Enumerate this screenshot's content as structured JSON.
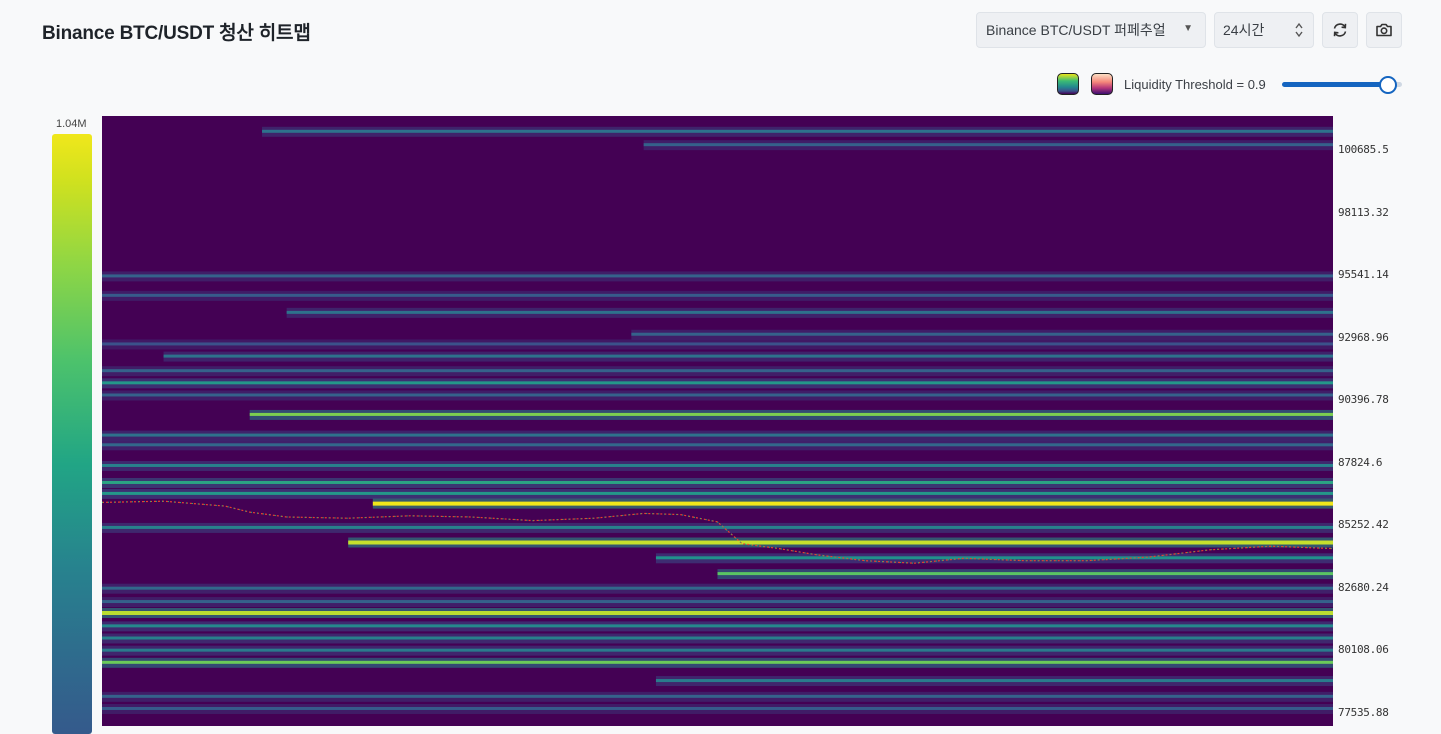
{
  "header": {
    "title": "Binance BTC/USDT 청산 히트맵",
    "symbol_select": "Binance BTC/USDT 퍼페추얼",
    "range_select": "24시간",
    "refresh_icon": "refresh-icon",
    "camera_icon": "camera-icon"
  },
  "controls": {
    "palette_icons": [
      "viridis-swatch",
      "magma-swatch"
    ],
    "threshold_label": "Liquidity Threshold = 0.9",
    "threshold_value": 0.9
  },
  "colorbar": {
    "max_label": "1.04M",
    "colors": [
      "#f0e71b",
      "#8ed645",
      "#21a585",
      "#2f6a8d"
    ]
  },
  "chart_data": {
    "type": "heatmap",
    "y_ticks": [
      "100685.5",
      "98113.32",
      "95541.14",
      "92968.96",
      "90396.78",
      "87824.6",
      "85252.42",
      "82680.24",
      "80108.06",
      "77535.88"
    ],
    "y_tick_values": [
      100685.5,
      98113.32,
      95541.14,
      92968.96,
      90396.78,
      87824.6,
      85252.42,
      82680.24,
      80108.06,
      77535.88
    ],
    "ylim": [
      77000,
      102100
    ],
    "time_range": "24시간",
    "background_color": "#440154",
    "liquidation_bands": [
      {
        "price": 101450,
        "intensity": 0.35,
        "start": 0.13
      },
      {
        "price": 100900,
        "intensity": 0.3,
        "start": 0.44
      },
      {
        "price": 95500,
        "intensity": 0.3,
        "start": 0.0
      },
      {
        "price": 94700,
        "intensity": 0.28,
        "start": 0.0
      },
      {
        "price": 94000,
        "intensity": 0.35,
        "start": 0.15
      },
      {
        "price": 93100,
        "intensity": 0.3,
        "start": 0.43
      },
      {
        "price": 92700,
        "intensity": 0.25,
        "start": 0.0
      },
      {
        "price": 92200,
        "intensity": 0.35,
        "start": 0.05
      },
      {
        "price": 91600,
        "intensity": 0.3,
        "start": 0.0
      },
      {
        "price": 91100,
        "intensity": 0.48,
        "start": 0.0
      },
      {
        "price": 90600,
        "intensity": 0.3,
        "start": 0.0
      },
      {
        "price": 89800,
        "intensity": 0.78,
        "start": 0.12
      },
      {
        "price": 88950,
        "intensity": 0.35,
        "start": 0.0
      },
      {
        "price": 88550,
        "intensity": 0.32,
        "start": 0.0
      },
      {
        "price": 87700,
        "intensity": 0.4,
        "start": 0.0
      },
      {
        "price": 87000,
        "intensity": 0.55,
        "start": 0.0
      },
      {
        "price": 86550,
        "intensity": 0.48,
        "start": 0.0
      },
      {
        "price": 86150,
        "intensity": 1.0,
        "start": 0.22
      },
      {
        "price": 85150,
        "intensity": 0.4,
        "start": 0.0
      },
      {
        "price": 84550,
        "intensity": 0.92,
        "start": 0.2
      },
      {
        "price": 83900,
        "intensity": 0.45,
        "start": 0.45
      },
      {
        "price": 83250,
        "intensity": 0.72,
        "start": 0.5
      },
      {
        "price": 82650,
        "intensity": 0.32,
        "start": 0.0
      },
      {
        "price": 82100,
        "intensity": 0.3,
        "start": 0.0
      },
      {
        "price": 81650,
        "intensity": 0.9,
        "start": 0.0
      },
      {
        "price": 81100,
        "intensity": 0.42,
        "start": 0.0
      },
      {
        "price": 80600,
        "intensity": 0.4,
        "start": 0.0
      },
      {
        "price": 80100,
        "intensity": 0.38,
        "start": 0.0
      },
      {
        "price": 79600,
        "intensity": 0.75,
        "start": 0.0
      },
      {
        "price": 78850,
        "intensity": 0.38,
        "start": 0.45
      },
      {
        "price": 78200,
        "intensity": 0.3,
        "start": 0.0
      },
      {
        "price": 77700,
        "intensity": 0.28,
        "start": 0.0
      }
    ],
    "price_series": [
      {
        "t": 0.0,
        "price": 86200
      },
      {
        "t": 0.05,
        "price": 86250
      },
      {
        "t": 0.1,
        "price": 86050
      },
      {
        "t": 0.12,
        "price": 85800
      },
      {
        "t": 0.15,
        "price": 85600
      },
      {
        "t": 0.2,
        "price": 85550
      },
      {
        "t": 0.25,
        "price": 85650
      },
      {
        "t": 0.3,
        "price": 85600
      },
      {
        "t": 0.35,
        "price": 85450
      },
      {
        "t": 0.4,
        "price": 85550
      },
      {
        "t": 0.44,
        "price": 85750
      },
      {
        "t": 0.47,
        "price": 85700
      },
      {
        "t": 0.5,
        "price": 85400
      },
      {
        "t": 0.52,
        "price": 84500
      },
      {
        "t": 0.55,
        "price": 84300
      },
      {
        "t": 0.58,
        "price": 84050
      },
      {
        "t": 0.62,
        "price": 83800
      },
      {
        "t": 0.66,
        "price": 83700
      },
      {
        "t": 0.7,
        "price": 83900
      },
      {
        "t": 0.75,
        "price": 83800
      },
      {
        "t": 0.8,
        "price": 83800
      },
      {
        "t": 0.85,
        "price": 83950
      },
      {
        "t": 0.9,
        "price": 84250
      },
      {
        "t": 0.95,
        "price": 84400
      },
      {
        "t": 1.0,
        "price": 84300
      }
    ]
  }
}
